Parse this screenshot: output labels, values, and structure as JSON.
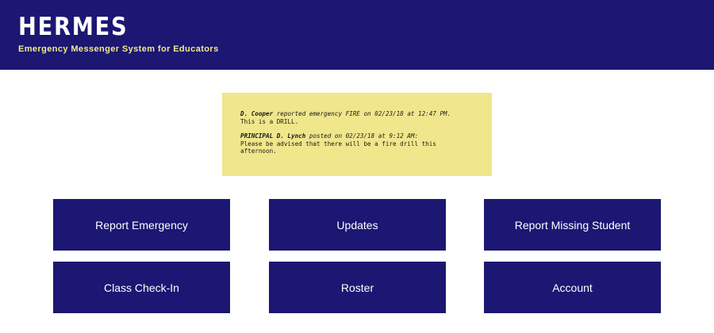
{
  "header": {
    "title": "HERMES",
    "subtitle": "Emergency Messenger System for Educators"
  },
  "notices": [
    {
      "author": "D. Cooper",
      "line1_middle": " reported emergency FIRE on 02/23/18 at 12:47 PM.",
      "line2": "This is a DRILL."
    },
    {
      "author": "PRINCIPAL D. Lynch",
      "line1_middle": " posted on 02/23/18 at 9:12 AM:",
      "line2": "Please be advised that there will be a fire drill this afternoon."
    }
  ],
  "actions": {
    "report_emergency": "Report Emergency",
    "updates": "Updates",
    "report_missing_student": "Report Missing Student",
    "class_check_in": "Class Check-In",
    "roster": "Roster",
    "account": "Account"
  },
  "colors": {
    "primary": "#1b1773",
    "notice_bg": "#f0e68c",
    "subtitle": "#f2ea8c",
    "background": "#ffffff"
  }
}
